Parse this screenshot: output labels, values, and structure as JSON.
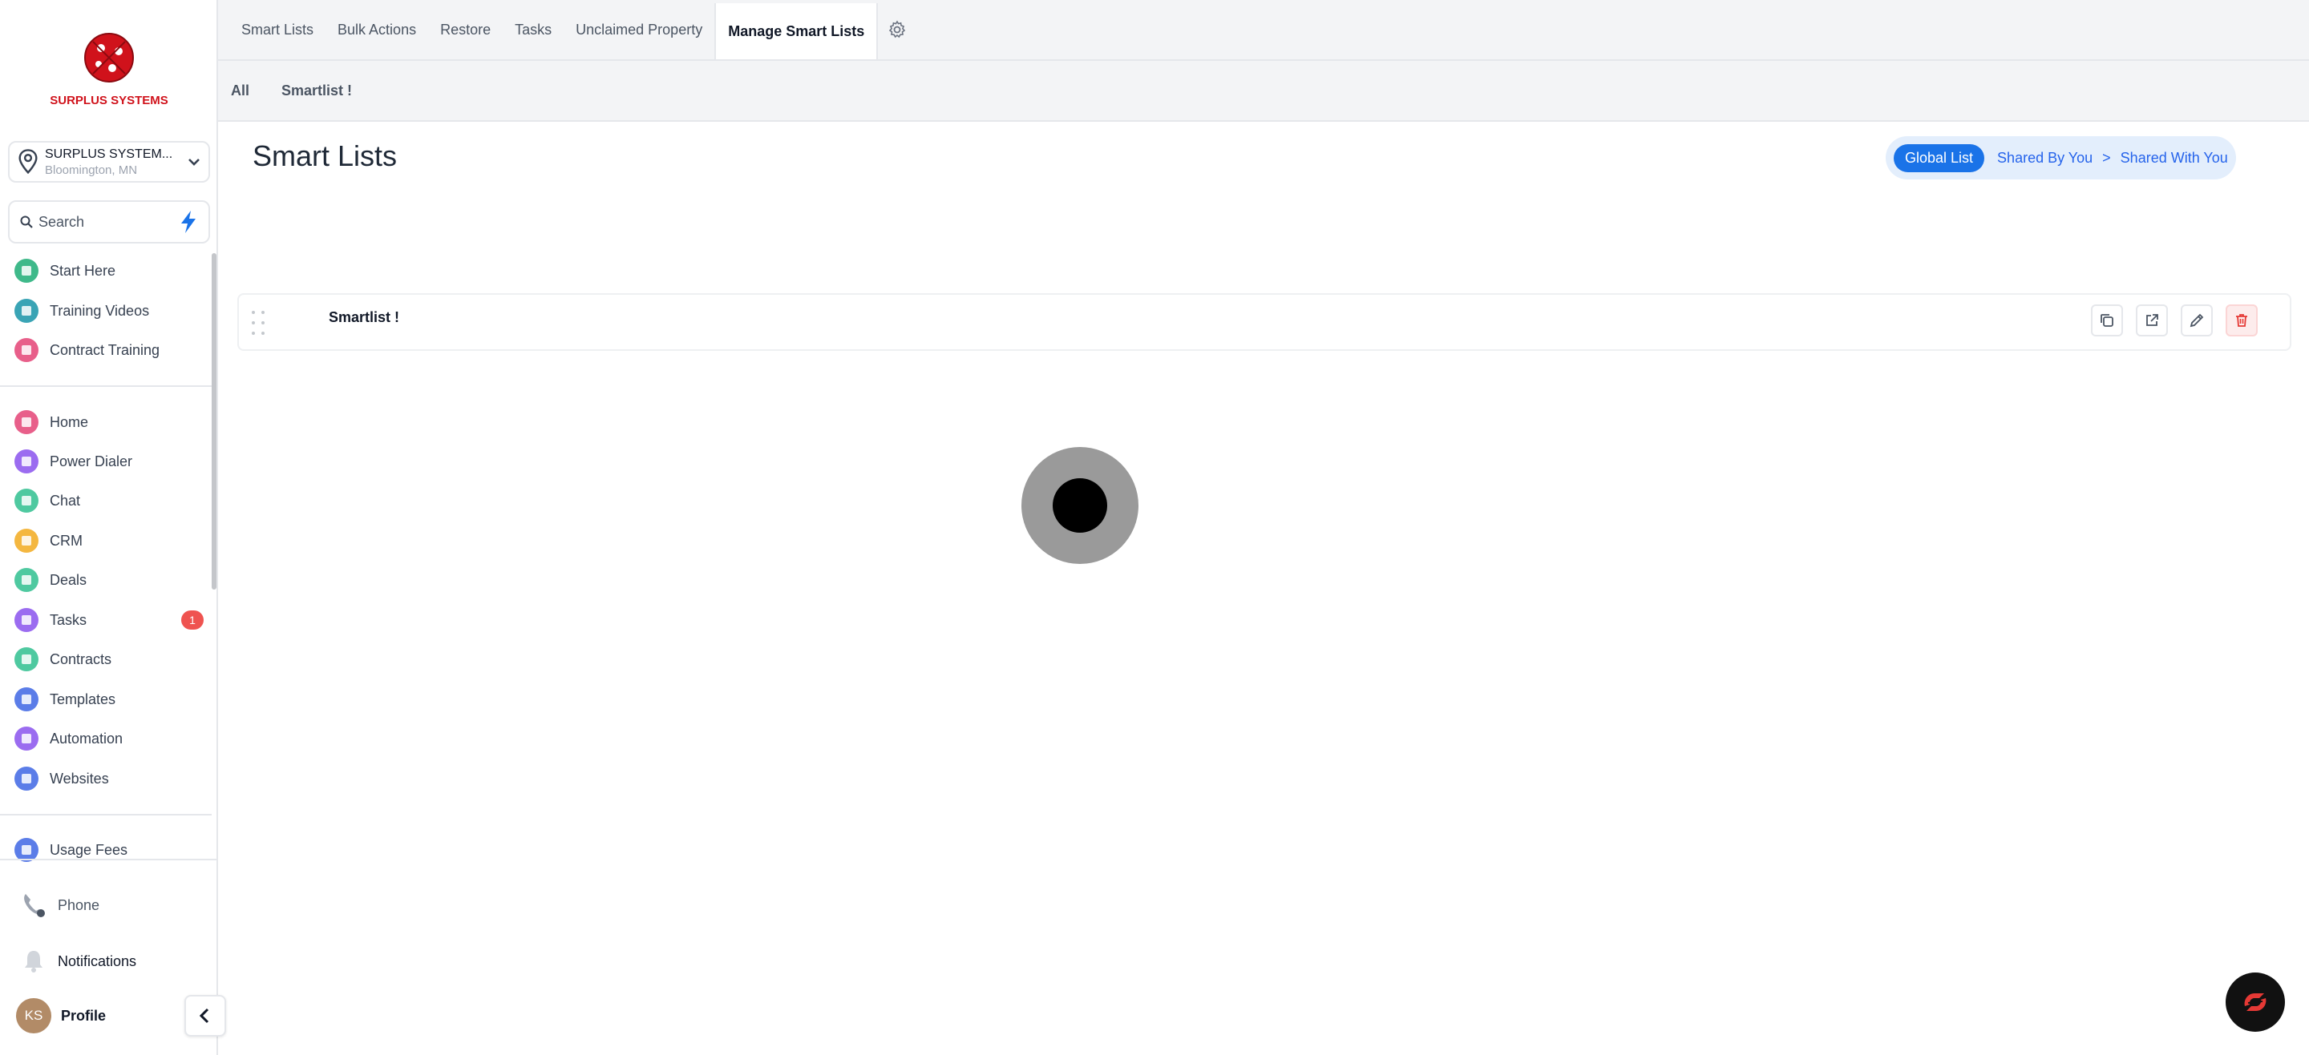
{
  "brand": {
    "name": "SURPLUS SYSTEMS"
  },
  "location": {
    "name": "SURPLUS SYSTEM...",
    "sub": "Bloomington, MN"
  },
  "search": {
    "placeholder": "Search"
  },
  "nav_top": [
    {
      "label": "Start Here",
      "color": "#3fb98a"
    },
    {
      "label": "Training Videos",
      "color": "#3aa4b5"
    },
    {
      "label": "Contract Training",
      "color": "#e85f8a"
    }
  ],
  "nav_main": [
    {
      "label": "Home",
      "color": "#e85f8a"
    },
    {
      "label": "Power Dialer",
      "color": "#9b6cf0"
    },
    {
      "label": "Chat",
      "color": "#4fc9a0"
    },
    {
      "label": "CRM",
      "color": "#f4b740"
    },
    {
      "label": "Deals",
      "color": "#4fc9a0"
    },
    {
      "label": "Tasks",
      "color": "#9b6cf0",
      "badge": "1"
    },
    {
      "label": "Contracts",
      "color": "#4fc9a0"
    },
    {
      "label": "Templates",
      "color": "#5b7de8"
    },
    {
      "label": "Automation",
      "color": "#9b6cf0"
    },
    {
      "label": "Websites",
      "color": "#5b7de8"
    }
  ],
  "nav_extra": [
    {
      "label": "Usage Fees",
      "color": "#5b7de8"
    }
  ],
  "bottom": {
    "phone": "Phone",
    "notifications": "Notifications",
    "profile": "Profile",
    "avatar_initials": "KS"
  },
  "tabs": [
    "Smart Lists",
    "Bulk Actions",
    "Restore",
    "Tasks",
    "Unclaimed Property",
    "Manage Smart Lists"
  ],
  "active_tab": "Manage Smart Lists",
  "subtabs": [
    "All",
    "Smartlist !"
  ],
  "page": {
    "title": "Smart Lists"
  },
  "share_toggle": {
    "active": "Global List",
    "opt1": "Shared By You",
    "separator": ">",
    "opt2": "Shared With You"
  },
  "smartlists": [
    {
      "name": "Smartlist !"
    }
  ],
  "colors": {
    "accent": "#1a73e8",
    "danger": "#e53935",
    "brand_red": "#d0121b"
  }
}
